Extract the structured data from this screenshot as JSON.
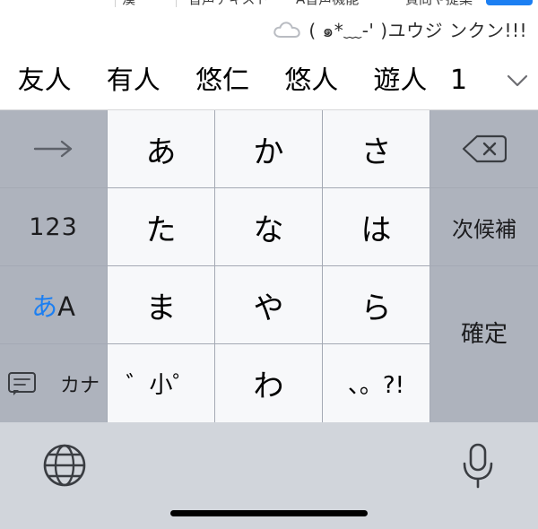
{
  "top_bar": {
    "fragments": [
      "漢",
      "音声テキスト",
      "A音声機能",
      "質問や提案"
    ],
    "accent_color": "#1c7ff2"
  },
  "prediction_row": {
    "icon": "cloud-icon",
    "text": "( ๑*﹏-' )ユウジ ンクン!!!"
  },
  "candidate_bar": {
    "items": [
      {
        "label": "友人"
      },
      {
        "label": "有人"
      },
      {
        "label": "悠仁"
      },
      {
        "label": "悠人"
      },
      {
        "label": "遊人"
      },
      {
        "label": "1"
      }
    ],
    "expand_icon": "chevron-down-icon"
  },
  "keyboard": {
    "rows": [
      [
        {
          "name": "key-arrow-right",
          "label": "→",
          "style": "dark",
          "icon": "arrow-right-icon"
        },
        {
          "name": "key-a",
          "label": "あ",
          "style": "light"
        },
        {
          "name": "key-ka",
          "label": "か",
          "style": "light"
        },
        {
          "name": "key-sa",
          "label": "さ",
          "style": "light"
        },
        {
          "name": "key-delete",
          "label": "⌫",
          "style": "dark",
          "icon": "delete-icon"
        }
      ],
      [
        {
          "name": "key-123",
          "label": "123",
          "style": "dark"
        },
        {
          "name": "key-ta",
          "label": "た",
          "style": "light"
        },
        {
          "name": "key-na",
          "label": "な",
          "style": "light"
        },
        {
          "name": "key-ha",
          "label": "は",
          "style": "light"
        },
        {
          "name": "key-next-candidate",
          "label": "次候補",
          "style": "dark"
        }
      ],
      [
        {
          "name": "key-abc-toggle",
          "label": "あA",
          "style": "dark"
        },
        {
          "name": "key-ma",
          "label": "ま",
          "style": "light"
        },
        {
          "name": "key-ya",
          "label": "や",
          "style": "light"
        },
        {
          "name": "key-ra",
          "label": "ら",
          "style": "light"
        },
        {
          "name": "key-confirm",
          "label": "確定",
          "style": "dark"
        }
      ],
      [
        {
          "name": "key-kana",
          "label": "カナ",
          "style": "dark",
          "icon": "speech-bubble-icon"
        },
        {
          "name": "key-dakuten",
          "label": "゛小゜",
          "style": "light"
        },
        {
          "name": "key-wa",
          "label": "わ",
          "style": "light"
        },
        {
          "name": "key-punctuation",
          "label": "、。?!",
          "style": "light"
        }
      ]
    ]
  },
  "bottom_bar": {
    "globe_icon": "globe-icon",
    "mic_icon": "microphone-icon",
    "home_indicator": "home-indicator"
  }
}
